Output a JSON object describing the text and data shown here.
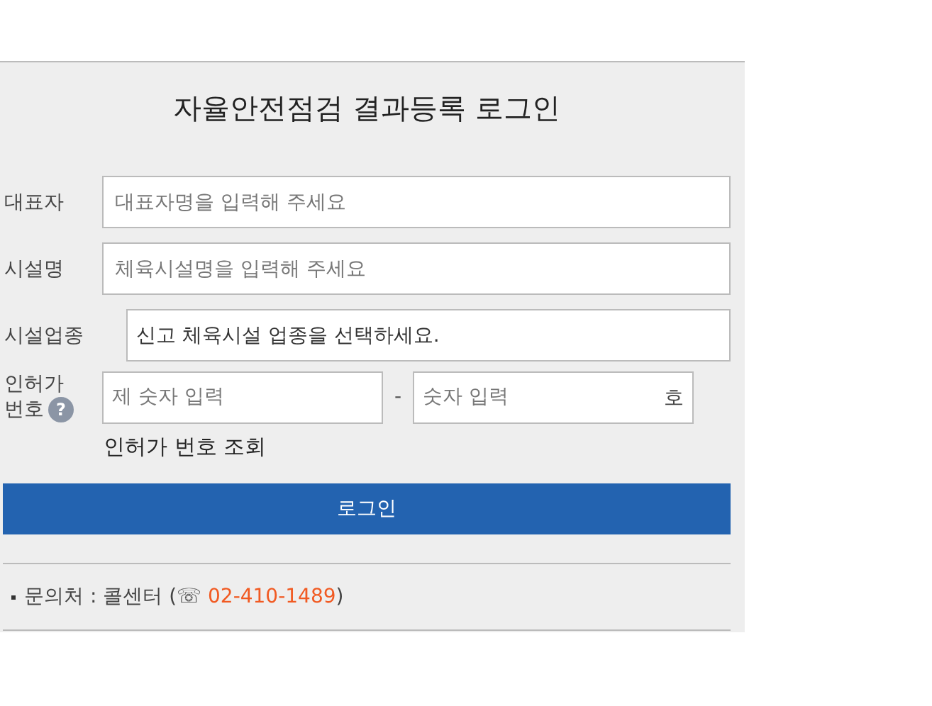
{
  "title": "자율안전점검 결과등록 로그인",
  "fields": [
    {
      "kind": "text",
      "label": "대표자",
      "placeholder": "대표자명을 입력해 주세요"
    },
    {
      "kind": "text",
      "label": "시설명",
      "placeholder": "체육시설명을 입력해 주세요"
    },
    {
      "kind": "select",
      "label": "시설업종",
      "value": "신고 체육시설 업종을 선택하세요."
    }
  ],
  "license": {
    "label_lines": [
      "인허가",
      "번호"
    ],
    "help": "?",
    "first_placeholder": "제 숫자 입력",
    "separator": "-",
    "second_placeholder": "숫자 입력",
    "suffix": "호",
    "lookup": "인허가 번호 조회"
  },
  "login_button": "로그인",
  "contact": {
    "text": "문의처 : 콜센터 (☏ ",
    "phone": "02-410-1489",
    "close": ")"
  }
}
